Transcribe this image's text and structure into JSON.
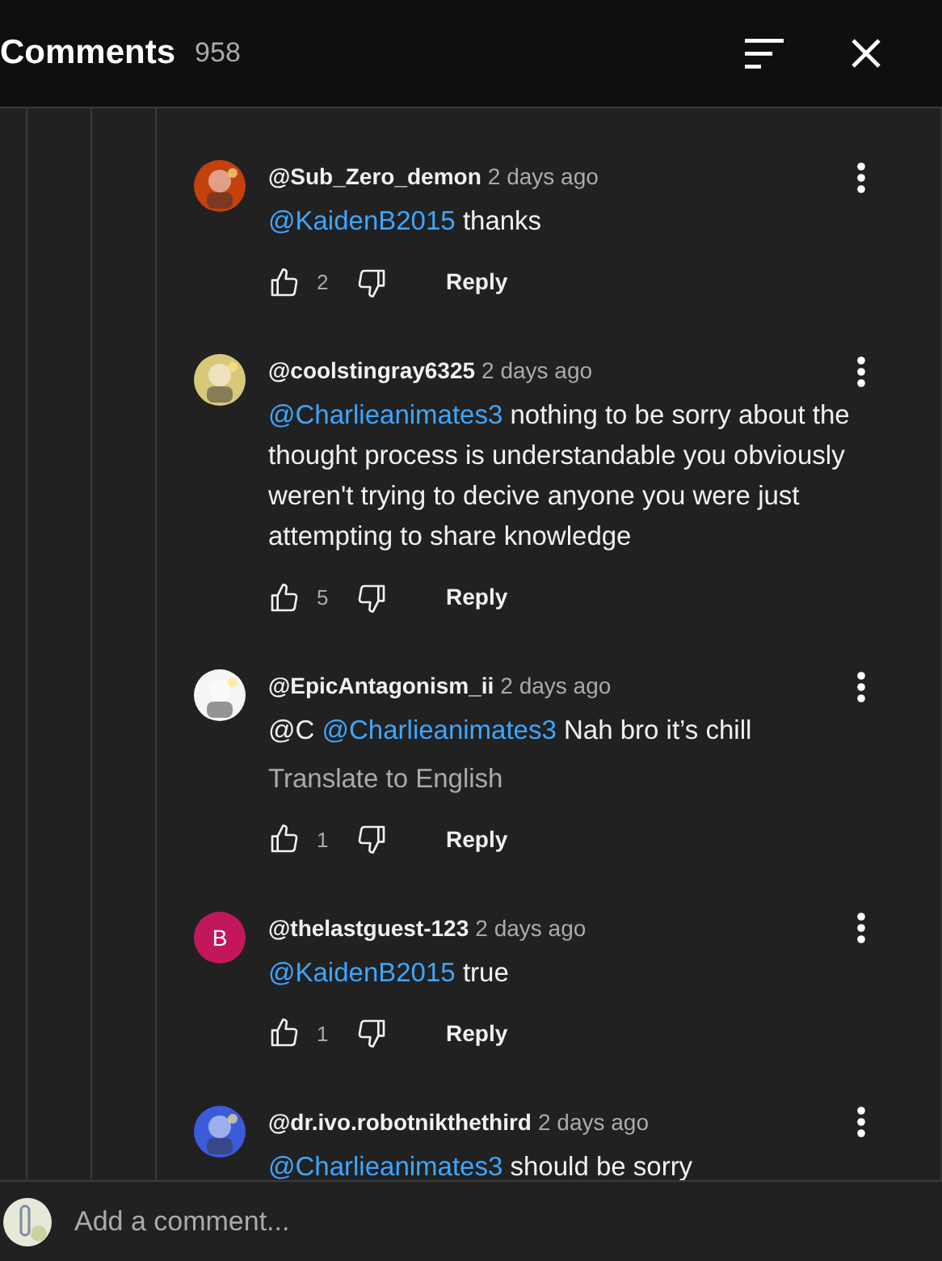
{
  "header": {
    "title": "Comments",
    "count": "958"
  },
  "comments": [
    {
      "author": "@Sub_Zero_demon",
      "time": "2 days ago",
      "avatar": {
        "kind": "picture"
      },
      "body": [
        {
          "kind": "mention",
          "text": "@KaidenB2015"
        },
        {
          "kind": "plain",
          "text": "thanks"
        }
      ],
      "likes": "2",
      "reply": "Reply"
    },
    {
      "author": "@coolstingray6325",
      "time": "2 days ago",
      "avatar": {
        "kind": "picture"
      },
      "body": [
        {
          "kind": "mention",
          "text": "@Charlieanimates3"
        },
        {
          "kind": "plain",
          "text": " nothing to be sorry about the thought process is understandable you obviously weren't trying to decive anyone you were just attempting to share knowledge"
        }
      ],
      "likes": "5",
      "reply": "Reply"
    },
    {
      "author": "@EpicAntagonism_ii",
      "time": "2 days ago",
      "avatar": {
        "kind": "picture"
      },
      "body": [
        {
          "kind": "plain",
          "text": "@C"
        },
        {
          "kind": "mention",
          "text": "@Charlieanimates3"
        },
        {
          "kind": "plain",
          "text": "Nah bro it’s chill"
        }
      ],
      "translate": "Translate to English",
      "likes": "1",
      "reply": "Reply"
    },
    {
      "author": "@thelastguest-123",
      "time": "2 days ago",
      "avatar": {
        "kind": "letter",
        "letter": "B",
        "color": "#c2185b"
      },
      "body": [
        {
          "kind": "mention",
          "text": "@KaidenB2015"
        },
        {
          "kind": "plain",
          "text": "true"
        }
      ],
      "likes": "1",
      "reply": "Reply"
    },
    {
      "author": "@dr.ivo.robotnikthethird",
      "time": "2 days ago",
      "avatar": {
        "kind": "picture"
      },
      "body": [
        {
          "kind": "mention",
          "text": "@Charlieanimates3"
        },
        {
          "kind": "plain",
          "text": "should be sorry"
        }
      ]
    }
  ],
  "composer": {
    "placeholder": "Add a comment..."
  }
}
